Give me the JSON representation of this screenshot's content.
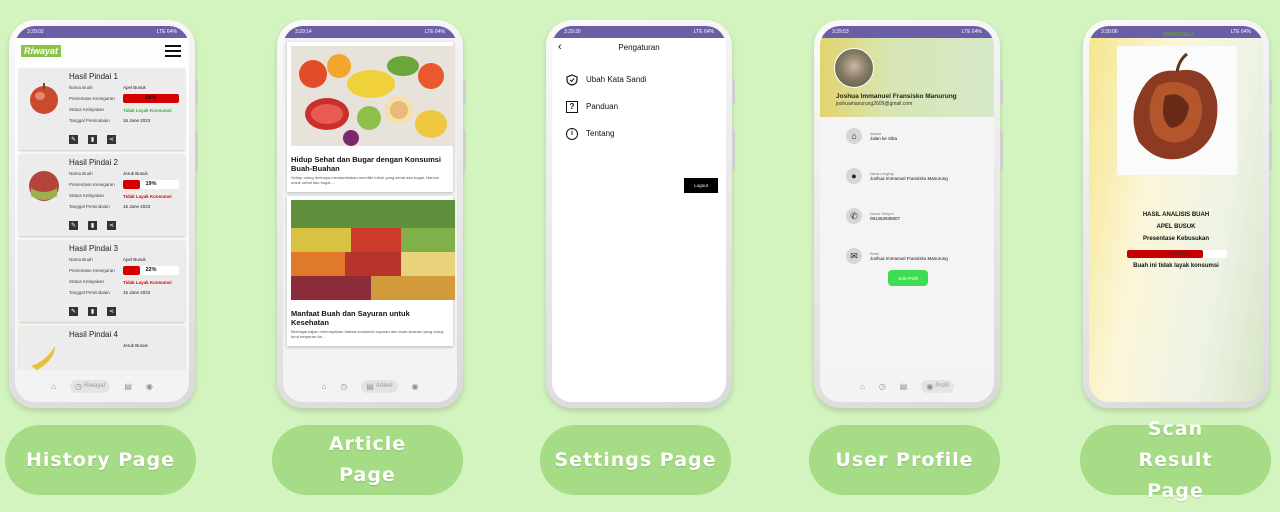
{
  "status_bars": {
    "history": {
      "time": "3:29:02",
      "battery": "64%",
      "network": "LTE"
    },
    "article": {
      "time": "3:29:14",
      "battery": "64%",
      "network": "LTE"
    },
    "settings": {
      "time": "3:29:30",
      "battery": "64%",
      "network": "LTE"
    },
    "profile": {
      "time": "3:29:53",
      "battery": "64%",
      "network": "LTE"
    },
    "scan": {
      "time": "3:30:06",
      "battery": "64%",
      "network": "LTE"
    }
  },
  "history": {
    "logo": "Riwayat",
    "labels": {
      "name": "Nama Buah",
      "pct": "Presentase Kesegaran",
      "status": "Status Kelayakan",
      "date": "Tanggal Pemindaian"
    },
    "cards": [
      {
        "title": "Hasil Pindai 1",
        "name": "Apel Busuk",
        "pct": 98,
        "pct_label": "98%",
        "status": "Tidak Layak Konsumsi",
        "status_color": "#2bb52b",
        "date": "16 Jane 2023"
      },
      {
        "title": "Hasil Pindai 2",
        "name": "Jeruk Busuk",
        "pct": 19,
        "pct_label": "19%",
        "status": "Tidak Layak Konsumsi",
        "status_color": "#e00000",
        "date": "16 Jane 2023"
      },
      {
        "title": "Hasil Pindai 3",
        "name": "Apel Busuk",
        "pct": 22,
        "pct_label": "22%",
        "status": "Tidak Layak Konsumsi",
        "status_color": "#e00000",
        "date": "16 Jane 2023"
      },
      {
        "title": "Hasil Pindai 4",
        "name": "Jeruk Busuk"
      }
    ],
    "nav": {
      "active_label": "Riwayat"
    }
  },
  "article": {
    "cards": [
      {
        "title": "Hidup Sehat dan Bugar dengan Konsumsi Buah-Buahan",
        "desc": "Setiap orang tentunya mendambakan memiliki tubuh yang sehat dan bugar. Namun untuk sehat dan bugar ..."
      },
      {
        "title": "Manfaat Buah dan Sayuran untuk Kesehatan",
        "desc": "Berbagai kajian menunjukkan bahwa konsumsi sayuran dan buah-buahan yang cukup turut berperan da..."
      }
    ],
    "nav": {
      "active_label": "Artikel"
    }
  },
  "settings": {
    "title": "Pengaturan",
    "items": [
      {
        "label": "Ubah Kata Sandi",
        "icon": "shield-icon"
      },
      {
        "label": "Panduan",
        "icon": "question-icon"
      },
      {
        "label": "Tentang",
        "icon": "info-icon"
      }
    ],
    "logout": "Logout"
  },
  "profile": {
    "name": "Joshua Immanuel Fransisko Manurung",
    "email": "joshuamanurung2609@gmail.com",
    "rows": [
      {
        "label": "Alamat",
        "value": "Jalan ke Siba",
        "icon": "home-icon"
      },
      {
        "label": "Nama Lengkap",
        "value": "Joshua Immanuel Fransisko Manurung",
        "icon": "person-icon"
      },
      {
        "label": "Nomor Telepon",
        "value": "081362935807",
        "icon": "phone-icon"
      },
      {
        "label": "Email",
        "value": "Joshua Immanuel Fransisko Manurung",
        "icon": "mail-icon"
      }
    ],
    "edit": "Edit Profil",
    "nav": {
      "active_label": "Profil"
    }
  },
  "scan": {
    "logo": "SEHATDALU",
    "heading": "HASIL ANALISIS BUAH",
    "fruit": "APEL BUSUK",
    "pct_title": "Presentase Kebusukan",
    "pct": 76.23,
    "pct_label": "76.23%",
    "verdict": "Buah ini tidak layak konsumsi"
  },
  "captions": [
    "History Page",
    "Article Page",
    "Settings Page",
    "User Profile",
    "Scan Result Page"
  ],
  "colors": {
    "background": "#d3f3bf",
    "caption_bg": "#a6dc85",
    "status_bar": "#6a5fa6",
    "danger": "#d40000",
    "success": "#3ddc52"
  }
}
